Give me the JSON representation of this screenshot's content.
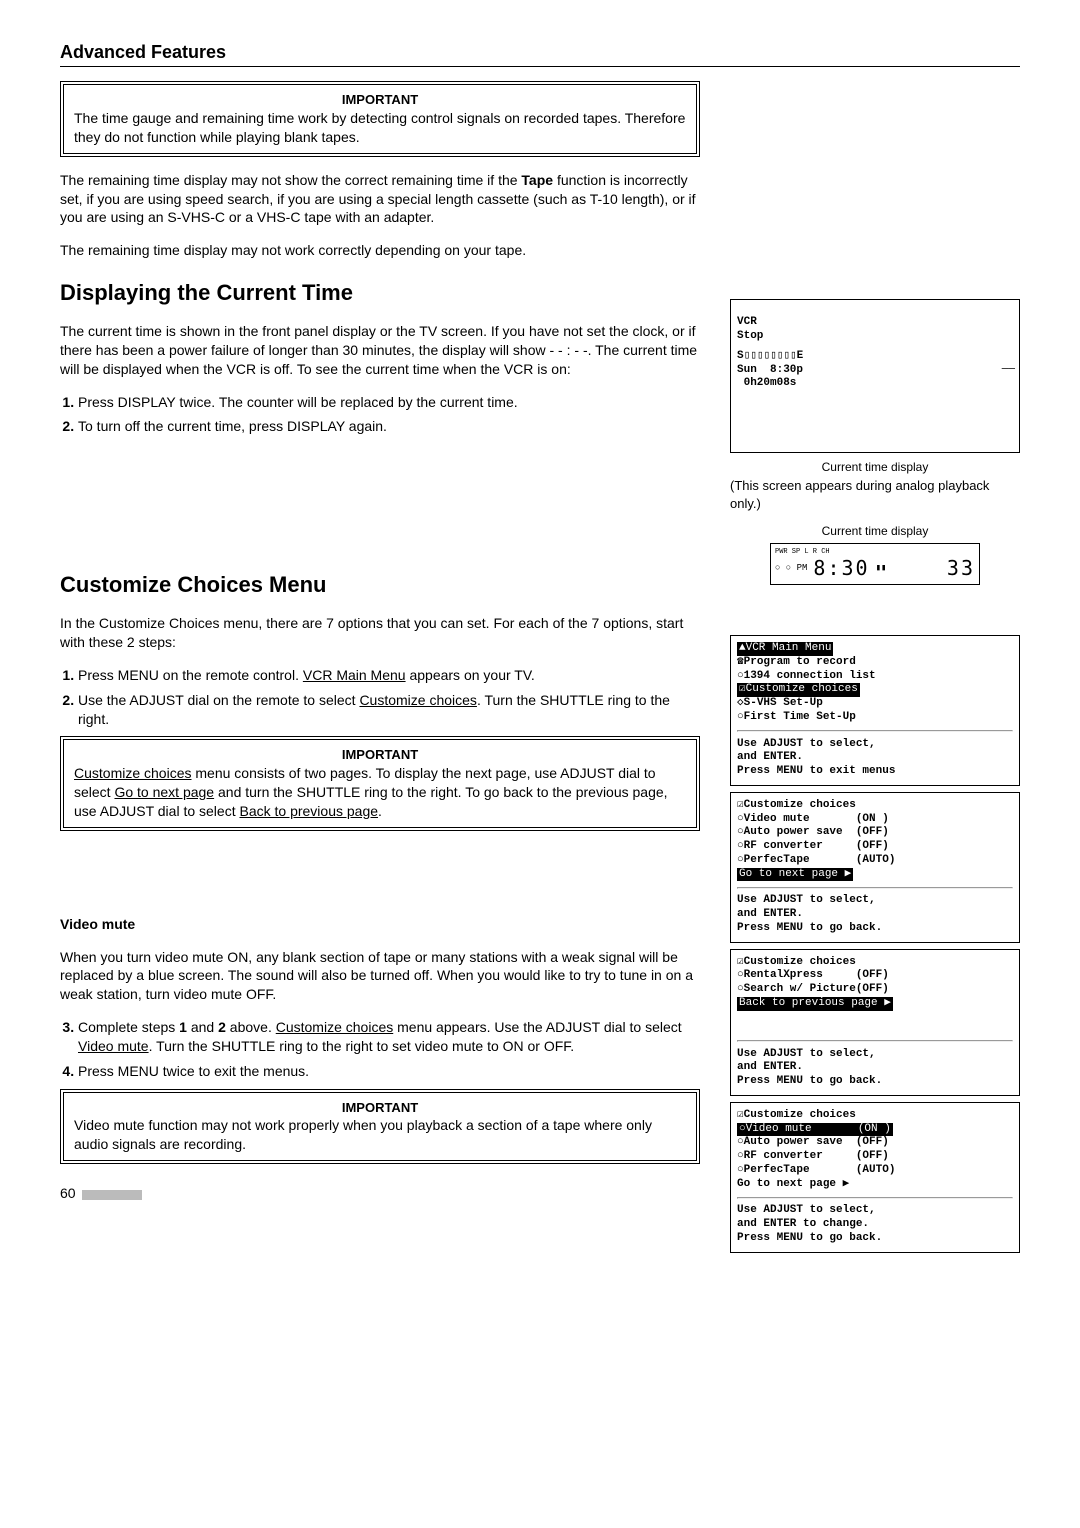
{
  "page": {
    "title": "Advanced Features",
    "pageNumber": "60"
  },
  "section1": {
    "importantLabel": "IMPORTANT",
    "importantText": "The time gauge and remaining time work by detecting control signals on recorded tapes.  Therefore they do not function while playing blank tapes.",
    "para1a": "The remaining time display may not show the correct remaining time if the ",
    "para1b": "Tape",
    "para1c": " function is incorrectly set, if you are using speed search, if you are using a special length cassette (such as T-10 length), or if you are using an S-VHS-C or a VHS-C tape with an adapter.",
    "para2": "The remaining time display may not work correctly depending on your tape."
  },
  "sectionTime": {
    "heading": "Displaying the Current Time",
    "para": "The current time is shown in the front panel display or the TV screen.  If you have not set the clock, or if there has been a power failure of longer than 30 minutes, the display will show - - : - -.  The current time will be displayed when the VCR is off.  To see the current time when the VCR is on:",
    "step1": "Press DISPLAY twice.  The counter will be replaced by the current time.",
    "step2": "To turn off the current time, press DISPLAY again."
  },
  "screenTime": {
    "l1": "VCR",
    "l2": "Stop",
    "l3": "S▯▯▯▯▯▯▯▯E",
    "l4": "Sun  8:30p",
    "l5": " 0h20m08s",
    "caption1": "Current time display",
    "caption2": "(This screen appears during analog playback only.)",
    "lcdCaption": "Current time display",
    "lcdTop": "PWR    SP        L R    CH",
    "lcdLeft": "○ ○ PM",
    "lcdBig": "8:30",
    "lcdRight": "33"
  },
  "sectionCustomize": {
    "heading": "Customize Choices Menu",
    "para": "In the Customize Choices menu, there are 7 options that you can set.  For each of the 7 options, start with these 2 steps:",
    "step1a": "Press MENU on the remote control.  ",
    "step1b": "VCR Main Menu",
    "step1c": " appears on your TV.",
    "step2a": "Use the ADJUST dial on the remote to select ",
    "step2b": "Customize choices",
    "step2c": ".  Turn the SHUTTLE ring to the right.",
    "importantLabel": "IMPORTANT",
    "imp_a": "Customize choices",
    "imp_b": " menu consists of two pages.  To display the next page, use ADJUST dial to select ",
    "imp_c": "Go to next page",
    "imp_d": " and turn the SHUTTLE ring to the right.  To go back to the previous page, use ADJUST dial to select ",
    "imp_e": "Back to previous page",
    "imp_f": "."
  },
  "sectionVideoMute": {
    "heading": "Video mute",
    "para": "When you turn video mute ON, any blank section of tape or many stations with a weak signal will be replaced by a blue screen.  The sound will also be turned off.  When you would like to try to tune in on a weak station, turn video mute OFF.",
    "step3a": "Complete steps ",
    "step3b": "1",
    "step3c": " and ",
    "step3d": "2",
    "step3e": " above.  ",
    "step3f": "Customize choices",
    "step3g": " menu appears.  Use the ADJUST dial to select ",
    "step3h": "Video mute",
    "step3i": ".  Turn the SHUTTLE ring to the right to set video mute to ON or OFF.",
    "step4": "Press MENU twice to exit the menus.",
    "importantLabel": "IMPORTANT",
    "importantText": "Video mute function may not work properly when you playback a section of a tape where only audio signals are recording."
  },
  "menu1": {
    "l1": "▲VCR Main Menu",
    "l2": "☎Program to record",
    "l3": "○1394 connection list",
    "l4": "☑Customize choices",
    "l5": "◇S-VHS Set-Up",
    "l6": "○First Time Set-Up",
    "l7": "Use ADJUST to select,",
    "l8": "and ENTER.",
    "l9": "Press MENU to exit menus"
  },
  "menu2": {
    "l1": "☑Customize choices",
    "l2": "○Video mute       (ON )",
    "l3": "○Auto power save  (OFF)",
    "l4": "○RF converter     (OFF)",
    "l5": "○PerfecTape       (AUTO)",
    "l6": "Go to next page ▶",
    "l7": "Use ADJUST to select,",
    "l8": "and ENTER.",
    "l9": "Press MENU to go back."
  },
  "menu3": {
    "l1": "☑Customize choices",
    "l2": "○RentalXpress     (OFF)",
    "l3": "○Search w/ Picture(OFF)",
    "l4": "Back to previous page ▶",
    "l7": "Use ADJUST to select,",
    "l8": "and ENTER.",
    "l9": "Press MENU to go back."
  },
  "menu4": {
    "l1": "☑Customize choices",
    "l2": "○Video mute       (ON )",
    "l3": "○Auto power save  (OFF)",
    "l4": "○RF converter     (OFF)",
    "l5": "○PerfecTape       (AUTO)",
    "l6": "Go to next page ▶",
    "l7": "Use ADJUST to select,",
    "l8": "and ENTER to change.",
    "l9": "Press MENU to go back."
  }
}
